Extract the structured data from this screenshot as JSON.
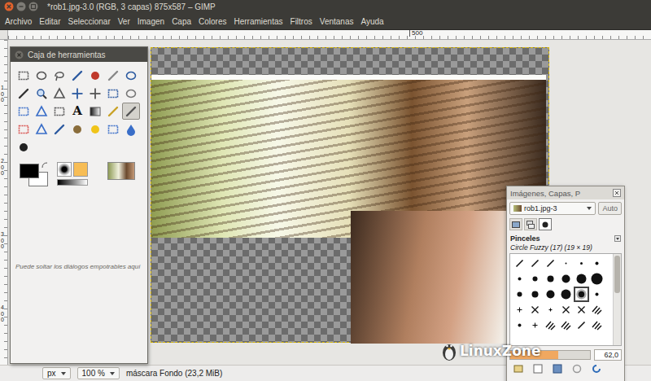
{
  "window": {
    "title": "*rob1.jpg-3.0 (RGB, 3 capas) 875x587 – GIMP"
  },
  "menu": [
    "Archivo",
    "Editar",
    "Seleccionar",
    "Ver",
    "Imagen",
    "Capa",
    "Colores",
    "Herramientas",
    "Filtros",
    "Ventanas",
    "Ayuda"
  ],
  "rulers": {
    "top": [
      "500"
    ],
    "left": [
      "100",
      "200",
      "300",
      "400"
    ]
  },
  "toolbox": {
    "title": "Caja de herramientas",
    "tools": [
      {
        "selected": false
      },
      {
        "selected": false
      },
      {
        "selected": false
      },
      {
        "selected": false
      },
      {
        "selected": false
      },
      {
        "selected": false
      },
      {
        "selected": false
      },
      {
        "selected": false
      },
      {
        "selected": false
      },
      {
        "selected": false
      },
      {
        "selected": false
      },
      {
        "selected": false
      },
      {
        "selected": false
      },
      {
        "selected": false
      },
      {
        "selected": false
      },
      {
        "selected": false
      },
      {
        "selected": false
      },
      {
        "selected": false,
        "glyph": "A"
      },
      {
        "selected": false
      },
      {
        "selected": false
      },
      {
        "selected": true
      },
      {
        "selected": false
      },
      {
        "selected": false
      },
      {
        "selected": false
      },
      {
        "selected": false
      },
      {
        "selected": false
      },
      {
        "selected": false
      },
      {
        "selected": false
      },
      {
        "selected": false
      }
    ],
    "colors": {
      "foreground": "#000000",
      "background": "#ffffff"
    },
    "hint": "Puede soltar los diálogos empotrables aquí"
  },
  "dock": {
    "title": "Imágenes, Capas, P",
    "image_menu": "rob1.jpg-3",
    "auto_button": "Auto",
    "tabs": [
      {
        "selected": false
      },
      {
        "selected": false
      },
      {
        "selected": true
      }
    ],
    "section": "Pinceles",
    "brush_name": "Circle Fuzzy (17) (19 × 19)",
    "brushes": [
      {
        "kind": "line",
        "selected": false
      },
      {
        "kind": "line",
        "selected": false
      },
      {
        "kind": "line",
        "selected": false
      },
      {
        "kind": "dot",
        "selected": false
      },
      {
        "kind": "dot",
        "selected": false
      },
      {
        "kind": "dot",
        "selected": false
      },
      {
        "kind": "dot",
        "selected": false
      },
      {
        "kind": "dot",
        "selected": false
      },
      {
        "kind": "dot",
        "selected": false
      },
      {
        "kind": "dot",
        "selected": false
      },
      {
        "kind": "dot",
        "selected": false
      },
      {
        "kind": "dot",
        "selected": false
      },
      {
        "kind": "dot",
        "selected": false
      },
      {
        "kind": "dot",
        "selected": false
      },
      {
        "kind": "dot",
        "selected": false
      },
      {
        "kind": "dot",
        "selected": false
      },
      {
        "kind": "fuzzy",
        "selected": true
      },
      {
        "kind": "dot",
        "selected": false
      },
      {
        "kind": "star",
        "selected": false
      },
      {
        "kind": "cross",
        "selected": false
      },
      {
        "kind": "star",
        "selected": false
      },
      {
        "kind": "cross",
        "selected": false
      },
      {
        "kind": "cross",
        "selected": false
      },
      {
        "kind": "hatch",
        "selected": false
      },
      {
        "kind": "dot",
        "selected": false
      },
      {
        "kind": "star",
        "selected": false
      },
      {
        "kind": "hatch",
        "selected": false
      },
      {
        "kind": "hatch",
        "selected": false
      },
      {
        "kind": "line",
        "selected": false
      },
      {
        "kind": "hatch",
        "selected": false
      }
    ],
    "spacing": {
      "level": 0.6,
      "reading": "62,0"
    }
  },
  "status_bar": {
    "unit": "px",
    "zoom": "100 %",
    "message": "máscara Fondo (23,2 MiB)"
  },
  "watermark": {
    "text": "LinuxZone"
  }
}
